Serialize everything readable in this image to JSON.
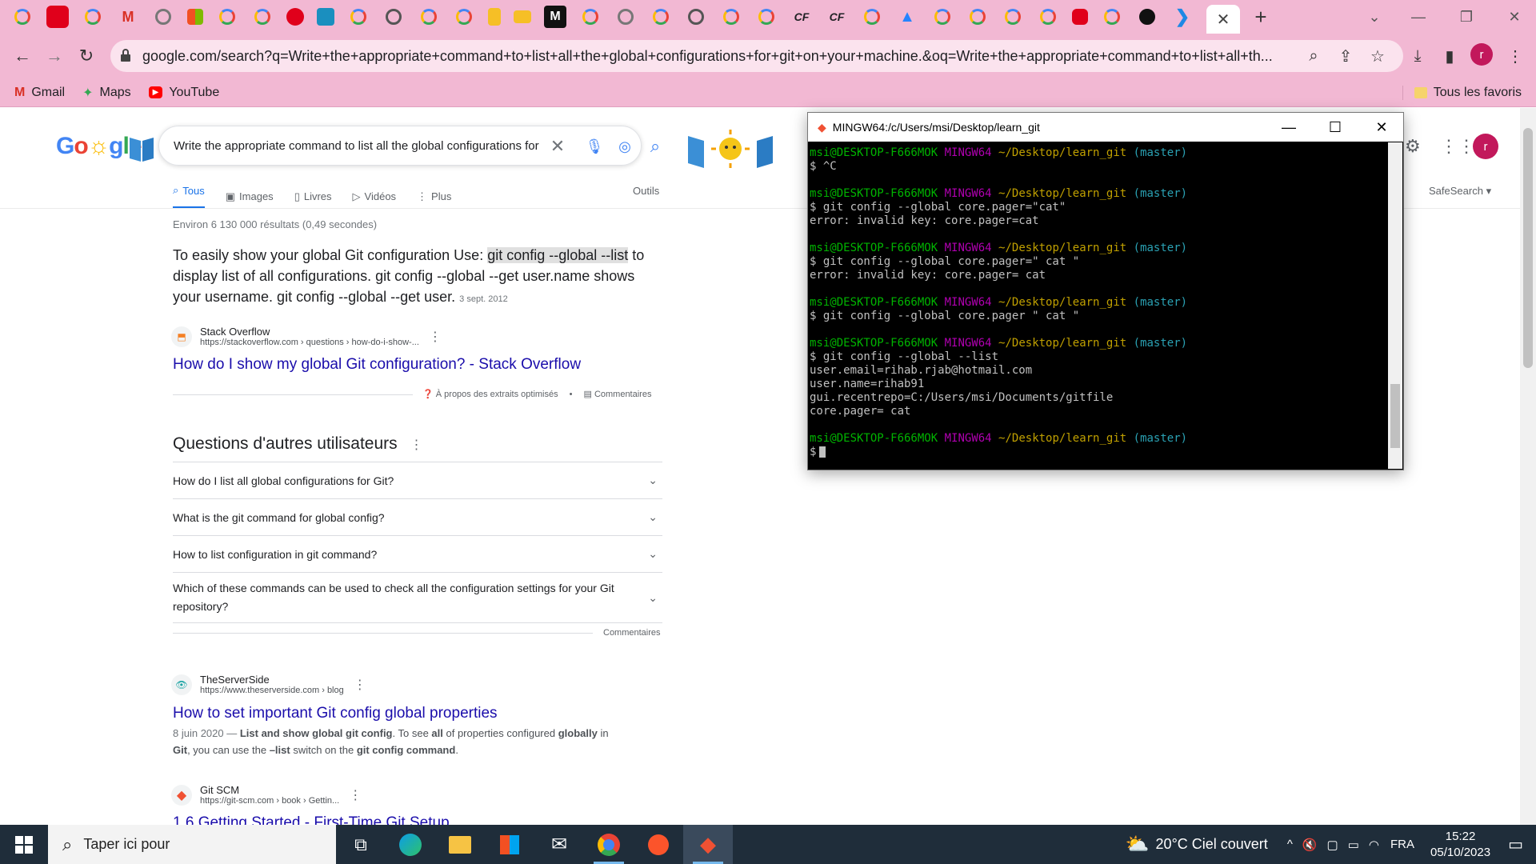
{
  "browser": {
    "url": "google.com/search?q=Write+the+appropriate+command+to+list+all+the+global+configurations+for+git+on+your+machine.&oq=Write+the+appropriate+command+to+list+all+th...",
    "bookmarks": [
      "Gmail",
      "Maps",
      "YouTube"
    ],
    "all_bookmarks": "Tous les favoris",
    "profile_initial": "r",
    "colors": {
      "frame": "#f2b8d3"
    }
  },
  "search": {
    "query": "Write the appropriate command to list all the global configurations for",
    "tabs": [
      "Tous",
      "Images",
      "Livres",
      "Vidéos",
      "Plus"
    ],
    "tools": "Outils",
    "safesearch": "SafeSearch",
    "stats": "Environ 6 130 000 résultats (0,49 secondes)"
  },
  "featured": {
    "text_before": "To easily show your global Git configuration Use: ",
    "highlight": "git config --global --list",
    "text_after": " to display list of all configurations. git config --global --get user.name shows your username. git config --global --get user. ",
    "date": "3 sept. 2012",
    "source_name": "Stack Overflow",
    "source_url": "https://stackoverflow.com › questions › how-do-i-show-...",
    "link": "How do I show my global Git configuration? - Stack Overflow",
    "about": "À propos des extraits optimisés",
    "comments": "Commentaires"
  },
  "paa": {
    "title": "Questions d'autres utilisateurs",
    "items": [
      "How do I list all global configurations for Git?",
      "What is the git command for global config?",
      "How to list configuration in git command?",
      "Which of these commands can be used to check all the configuration settings for your Git repository?"
    ],
    "comments": "Commentaires"
  },
  "results": [
    {
      "source_name": "TheServerSide",
      "source_url": "https://www.theserverside.com › blog",
      "link": "How to set important Git config global properties",
      "date": "8 juin 2020 — ",
      "desc_1": "List and show global git config",
      "desc_2": ". To see ",
      "desc_3": "all",
      "desc_4": " of properties configured ",
      "desc_5": "globally",
      "desc_6": " in ",
      "desc_7": "Git",
      "desc_8": ", you can use the ",
      "desc_9": "–list",
      "desc_10": " switch on the ",
      "desc_11": "git config command",
      "desc_12": "."
    },
    {
      "source_name": "Git SCM",
      "source_url": "https://git-scm.com › book › Gettin...",
      "link": "1.6 Getting Started - First-Time Git Setup"
    }
  ],
  "terminal": {
    "title": "MINGW64:/c/Users/msi/Desktop/learn_git",
    "prompt_user": "msi@DESKTOP-F666MOK",
    "prompt_env": "MINGW64",
    "prompt_path": "~/Desktop/learn_git",
    "prompt_branch": "(master)",
    "blocks": [
      {
        "lines": [
          "$ ^C"
        ]
      },
      {
        "lines": [
          "$ git config --global core.pager=\"cat\"",
          "error: invalid key: core.pager=cat"
        ]
      },
      {
        "lines": [
          "$ git config --global core.pager=\" cat \"",
          "error: invalid key: core.pager= cat"
        ]
      },
      {
        "lines": [
          "$ git config --global core.pager \" cat \""
        ]
      },
      {
        "lines": [
          "$ git config --global --list",
          "user.email=rihab.rjab@hotmail.com",
          "user.name=rihab91",
          "gui.recentrepo=C:/Users/msi/Documents/gitfile",
          "core.pager= cat"
        ]
      },
      {
        "lines": [
          "$"
        ]
      }
    ]
  },
  "taskbar": {
    "search_placeholder": "Taper ici pour",
    "weather": "20°C  Ciel couvert",
    "lang": "FRA",
    "time": "15:22",
    "date": "05/10/2023"
  }
}
